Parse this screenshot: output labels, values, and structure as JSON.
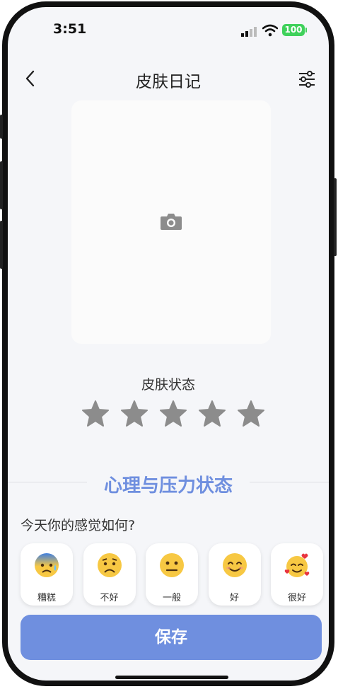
{
  "status_bar": {
    "time": "3:51",
    "battery": "100"
  },
  "nav": {
    "title": "皮肤日记",
    "back_icon": "chevron-left-icon",
    "filter_icon": "sliders-icon"
  },
  "photo": {
    "icon": "camera-icon"
  },
  "skin_status": {
    "title": "皮肤状态",
    "rating": 0,
    "max_rating": 5
  },
  "mental": {
    "section_title": "心理与压力状态",
    "question": "今天你的感觉如何?",
    "moods": [
      {
        "label": "糟糕",
        "icon": "anxious-face-icon"
      },
      {
        "label": "不好",
        "icon": "worried-face-icon"
      },
      {
        "label": "一般",
        "icon": "neutral-face-icon"
      },
      {
        "label": "好",
        "icon": "smiling-face-icon"
      },
      {
        "label": "很好",
        "icon": "smiling-face-with-hearts-icon"
      }
    ]
  },
  "actions": {
    "save_label": "保存"
  },
  "colors": {
    "accent": "#6f8fdf",
    "star": "#8c8c8c",
    "battery": "#3fd15b"
  }
}
